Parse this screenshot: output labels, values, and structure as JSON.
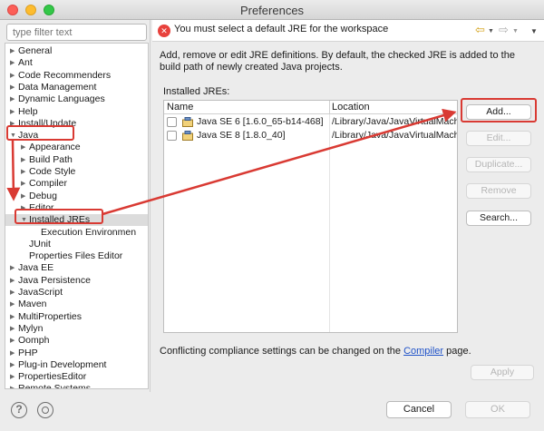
{
  "window": {
    "title": "Preferences"
  },
  "left": {
    "filter_placeholder": "type filter text",
    "tree": [
      {
        "label": "General",
        "arrow": "▶",
        "level": 0
      },
      {
        "label": "Ant",
        "arrow": "▶",
        "level": 0
      },
      {
        "label": "Code Recommenders",
        "arrow": "▶",
        "level": 0
      },
      {
        "label": "Data Management",
        "arrow": "▶",
        "level": 0
      },
      {
        "label": "Dynamic Languages",
        "arrow": "▶",
        "level": 0
      },
      {
        "label": "Help",
        "arrow": "▶",
        "level": 0
      },
      {
        "label": "Install/Update",
        "arrow": "▶",
        "level": 0
      },
      {
        "label": "Java",
        "arrow": "▼",
        "level": 0
      },
      {
        "label": "Appearance",
        "arrow": "▶",
        "level": 1
      },
      {
        "label": "Build Path",
        "arrow": "▶",
        "level": 1
      },
      {
        "label": "Code Style",
        "arrow": "▶",
        "level": 1
      },
      {
        "label": "Compiler",
        "arrow": "▶",
        "level": 1
      },
      {
        "label": "Debug",
        "arrow": "▶",
        "level": 1
      },
      {
        "label": "Editor",
        "arrow": "▶",
        "level": 1
      },
      {
        "label": "Installed JREs",
        "arrow": "▼",
        "level": 1
      },
      {
        "label": "Execution Environmen",
        "arrow": "",
        "level": 2
      },
      {
        "label": "JUnit",
        "arrow": "",
        "level": 1
      },
      {
        "label": "Properties Files Editor",
        "arrow": "",
        "level": 1
      },
      {
        "label": "Java EE",
        "arrow": "▶",
        "level": 0
      },
      {
        "label": "Java Persistence",
        "arrow": "▶",
        "level": 0
      },
      {
        "label": "JavaScript",
        "arrow": "▶",
        "level": 0
      },
      {
        "label": "Maven",
        "arrow": "▶",
        "level": 0
      },
      {
        "label": "MultiProperties",
        "arrow": "▶",
        "level": 0
      },
      {
        "label": "Mylyn",
        "arrow": "▶",
        "level": 0
      },
      {
        "label": "Oomph",
        "arrow": "▶",
        "level": 0
      },
      {
        "label": "PHP",
        "arrow": "▶",
        "level": 0
      },
      {
        "label": "Plug-in Development",
        "arrow": "▶",
        "level": 0
      },
      {
        "label": "PropertiesEditor",
        "arrow": "▶",
        "level": 0
      },
      {
        "label": "Remote Systems",
        "arrow": "▶",
        "level": 0
      }
    ],
    "selected_index": 14
  },
  "header": {
    "error_message": "You must select a default JRE for the workspace",
    "back_glyph": "⇦",
    "forward_glyph": "⇨",
    "dropdown_glyph": "▼"
  },
  "main": {
    "description": "Add, remove or edit JRE definitions. By default, the checked JRE is added to the build path of newly created Java projects.",
    "installed_label": "Installed JREs:",
    "columns": [
      "Name",
      "Location"
    ],
    "rows": [
      {
        "name": "Java SE 6 [1.6.0_65-b14-468]",
        "location": "/Library/Java/JavaVirtualMach"
      },
      {
        "name": "Java SE 8 [1.8.0_40]",
        "location": "/Library/Java/JavaVirtualMach"
      }
    ],
    "buttons": {
      "add": "Add...",
      "edit": "Edit...",
      "duplicate": "Duplicate...",
      "remove": "Remove",
      "search": "Search..."
    },
    "conflict_prefix": "Conflicting compliance settings can be changed on the ",
    "conflict_link": "Compiler",
    "conflict_suffix": " page.",
    "apply": "Apply"
  },
  "footer": {
    "help_glyph": "?",
    "cancel": "Cancel",
    "ok": "OK"
  },
  "colors": {
    "annotation_red": "#d93a33",
    "error_red": "#e8413c",
    "link_blue": "#1f52c8"
  }
}
